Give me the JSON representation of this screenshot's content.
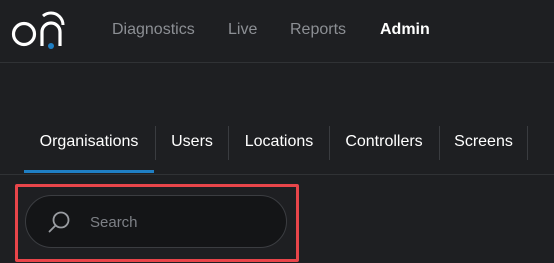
{
  "app": {
    "logo_text": "on"
  },
  "nav": {
    "items": [
      {
        "label": "Diagnostics"
      },
      {
        "label": "Live"
      },
      {
        "label": "Reports"
      },
      {
        "label": "Admin",
        "active": true
      }
    ]
  },
  "tabs": [
    {
      "label": "Organisations",
      "active": true
    },
    {
      "label": "Users"
    },
    {
      "label": "Locations"
    },
    {
      "label": "Controllers"
    },
    {
      "label": "Screens"
    }
  ],
  "search": {
    "placeholder": "Search",
    "value": ""
  },
  "colors": {
    "accent": "#1f7fc4",
    "highlight": "#e8454a",
    "background": "#1e1f22"
  }
}
